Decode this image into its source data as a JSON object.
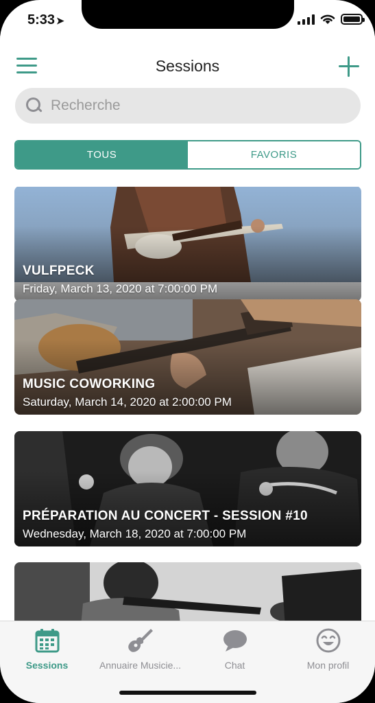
{
  "status_bar": {
    "time": "5:33",
    "location_arrow": "location-arrow-icon"
  },
  "header": {
    "title": "Sessions",
    "menu_icon": "hamburger-menu-icon",
    "add_icon": "plus-icon"
  },
  "search": {
    "placeholder": "Recherche",
    "value": ""
  },
  "segments": [
    {
      "label": "TOUS",
      "active": true
    },
    {
      "label": "FAVORIS",
      "active": false
    }
  ],
  "sessions": [
    {
      "title": "VULFPECK",
      "date": "Friday, March 13, 2020 at 7:00:00 PM"
    },
    {
      "title": "MUSIC COWORKING",
      "date": "Saturday, March 14, 2020 at 2:00:00 PM"
    },
    {
      "title": "PRÉPARATION AU CONCERT - SESSION #10",
      "date": "Wednesday, March 18, 2020 at 7:00:00 PM"
    },
    {
      "title": "",
      "date": ""
    }
  ],
  "tabbar": {
    "items": [
      {
        "label": "Sessions",
        "icon": "calendar-icon",
        "active": true
      },
      {
        "label": "Annuaire Musicie...",
        "icon": "guitar-icon",
        "active": false
      },
      {
        "label": "Chat",
        "icon": "chat-bubble-icon",
        "active": false
      },
      {
        "label": "Mon profil",
        "icon": "smiley-face-icon",
        "active": false
      }
    ]
  },
  "colors": {
    "accent": "#3e9a88",
    "inactive": "#8e8e93"
  }
}
